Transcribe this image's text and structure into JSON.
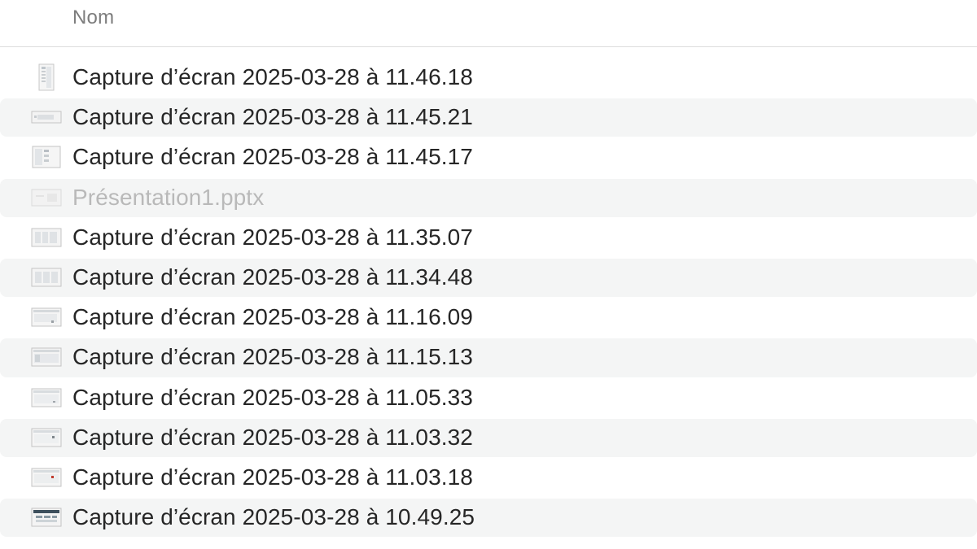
{
  "header": {
    "column_name": "Nom"
  },
  "files": [
    {
      "name": "Capture d’écran 2025-03-28 à 11.46.18",
      "icon": "portrait-screenshot-thumbnail-icon",
      "dimmed": false
    },
    {
      "name": "Capture d’écran 2025-03-28 à 11.45.21",
      "icon": "wide-screenshot-thumbnail-icon",
      "dimmed": false
    },
    {
      "name": "Capture d’écran 2025-03-28 à 11.45.17",
      "icon": "screenshot-thumbnail-icon",
      "dimmed": false
    },
    {
      "name": "Présentation1.pptx",
      "icon": "presentation-file-icon",
      "dimmed": true
    },
    {
      "name": "Capture d’écran 2025-03-28 à 11.35.07",
      "icon": "screenshot-thumbnail-icon",
      "dimmed": false
    },
    {
      "name": "Capture d’écran 2025-03-28 à 11.34.48",
      "icon": "screenshot-thumbnail-icon",
      "dimmed": false
    },
    {
      "name": "Capture d’écran 2025-03-28 à 11.16.09",
      "icon": "screenshot-thumbnail-icon",
      "dimmed": false
    },
    {
      "name": "Capture d’écran 2025-03-28 à 11.15.13",
      "icon": "screenshot-thumbnail-icon",
      "dimmed": false
    },
    {
      "name": "Capture d’écran 2025-03-28 à 11.05.33",
      "icon": "screenshot-thumbnail-icon",
      "dimmed": false
    },
    {
      "name": "Capture d’écran 2025-03-28 à 11.03.32",
      "icon": "screenshot-thumbnail-icon",
      "dimmed": false
    },
    {
      "name": "Capture d’écran 2025-03-28 à 11.03.18",
      "icon": "screenshot-thumbnail-icon",
      "dimmed": false
    },
    {
      "name": "Capture d’écran 2025-03-28 à 10.49.25",
      "icon": "screenshot-thumbnail-icon",
      "dimmed": false
    }
  ],
  "colors": {
    "row_stripe": "#f4f5f5",
    "text_primary": "#262626",
    "text_dimmed": "#b9b9b9",
    "header_text": "#7d7d7d"
  }
}
